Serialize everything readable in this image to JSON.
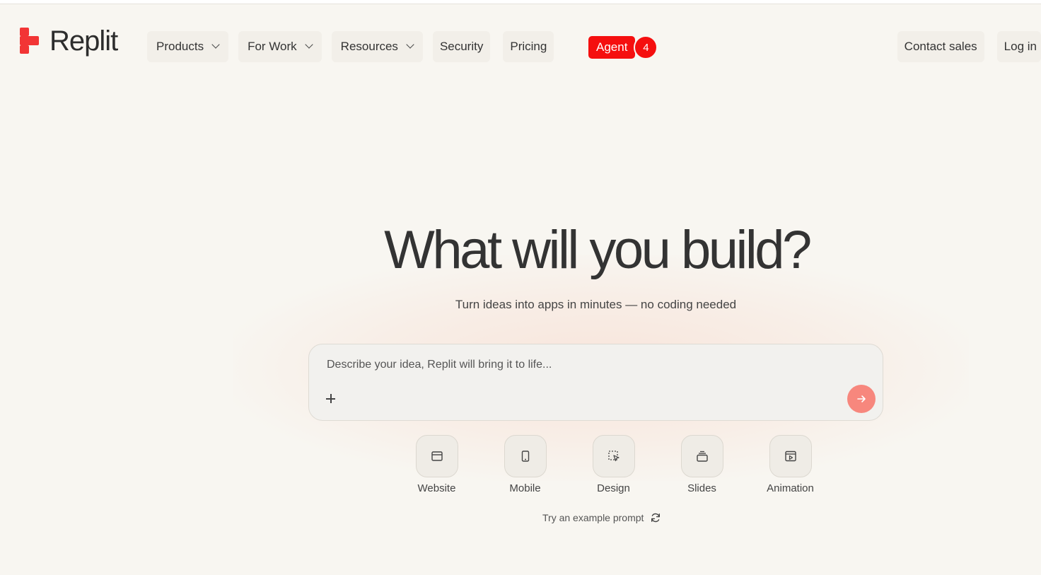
{
  "brand": {
    "name": "Replit",
    "color": "#f23535"
  },
  "nav": {
    "products": "Products",
    "for_work": "For Work",
    "resources": "Resources",
    "security": "Security",
    "pricing": "Pricing",
    "agent": "Agent",
    "agent_count": "4",
    "contact_sales": "Contact sales",
    "login": "Log in"
  },
  "hero": {
    "title": "What will you build?",
    "subtitle": "Turn ideas into apps in minutes — no coding needed"
  },
  "prompt": {
    "placeholder": "Describe your idea, Replit will bring it to life...",
    "send_color": "#f7877d"
  },
  "categories": [
    {
      "label": "Website",
      "icon": "browser-window-icon"
    },
    {
      "label": "Mobile",
      "icon": "smartphone-icon"
    },
    {
      "label": "Design",
      "icon": "selection-cursor-icon"
    },
    {
      "label": "Slides",
      "icon": "slides-stack-icon"
    },
    {
      "label": "Animation",
      "icon": "play-frame-icon"
    }
  ],
  "example_prompt": "Try an example prompt",
  "colors": {
    "accent": "#f50f0f",
    "background": "#f8f6f1"
  }
}
